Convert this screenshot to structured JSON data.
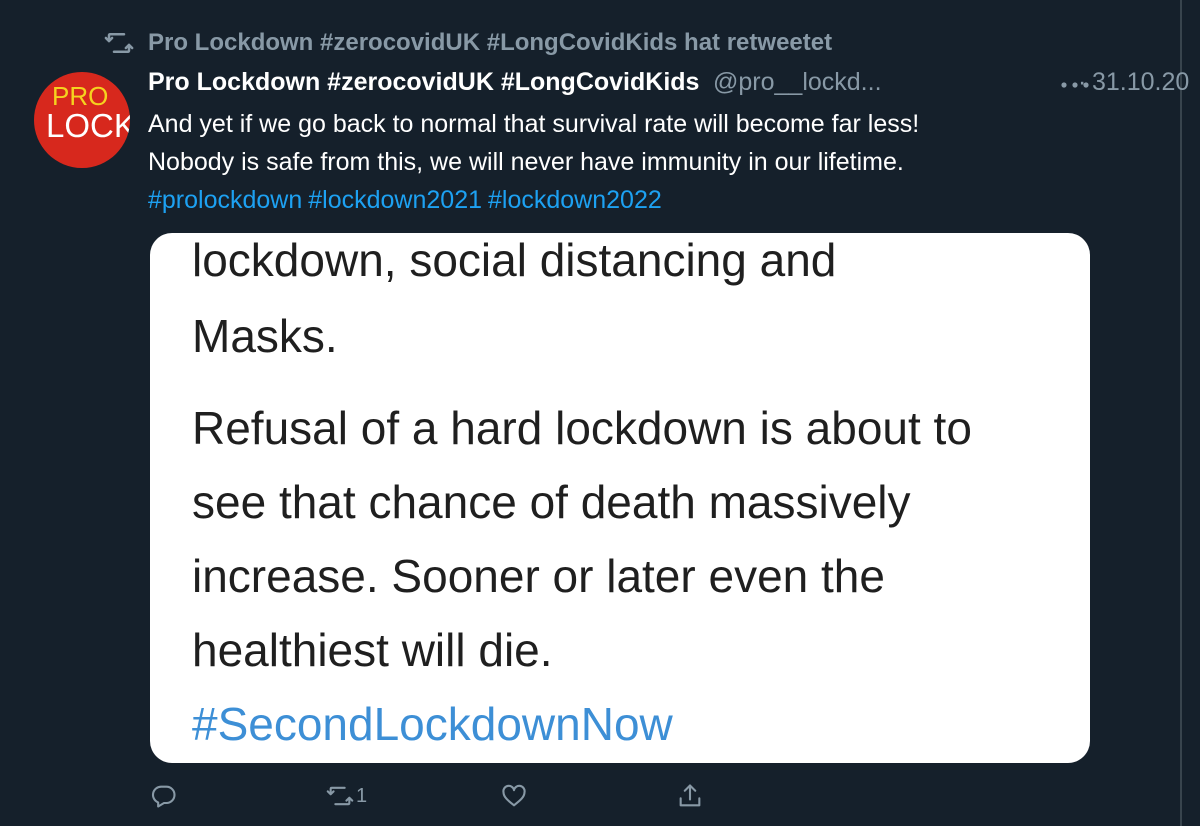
{
  "retweet_header": {
    "text": "Pro Lockdown #zerocovidUK #LongCovidKids hat retweetet",
    "icon": "retweet-icon"
  },
  "avatar": {
    "line1": "PRO",
    "line2": "LOCK",
    "colors": {
      "background": "#d7281d",
      "line1": "#f5d21f",
      "line2": "#ffffff"
    }
  },
  "tweet": {
    "display_name": "Pro Lockdown #zerocovidUK #LongCovidKids",
    "handle": "@pro__lockd...",
    "separator": "·",
    "date": "31.10.20",
    "more_icon": "more-horizontal-icon",
    "text_lines": [
      "And yet if we go back to normal that survival rate will become far less!",
      "Nobody is safe from this, we will never have immunity in our lifetime."
    ],
    "hashtags": [
      "#prolockdown",
      "#lockdown2021",
      "#lockdown2022"
    ]
  },
  "media": {
    "lines": [
      "lockdown, social distancing and",
      "Masks.",
      "Refusal of a hard lockdown is about to",
      "see that chance of death massively",
      "increase. Sooner or later even the",
      "healthiest will die."
    ],
    "hashtag": "#SecondLockdownNow"
  },
  "actions": {
    "reply": {
      "icon": "reply-icon",
      "count": ""
    },
    "retweet": {
      "icon": "retweet-icon",
      "count": "1"
    },
    "like": {
      "icon": "heart-icon",
      "count": ""
    },
    "share": {
      "icon": "share-icon",
      "count": ""
    }
  },
  "colors": {
    "background": "#15202b",
    "secondary_text": "#8899a6",
    "link": "#1da1f2",
    "media_link": "#3d8fd6"
  }
}
